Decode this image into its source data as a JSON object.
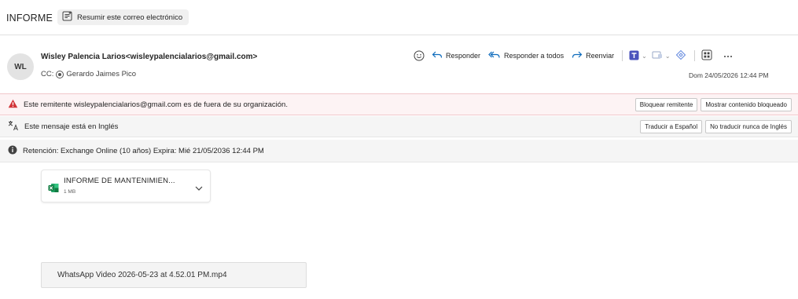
{
  "subject": "INFORME",
  "summarize_label": "Resumir este correo electrónico",
  "sender": {
    "initials": "WL",
    "from_line": "Wisley Palencia Larios<wisleypalencialarios@gmail.com>",
    "cc_prefix": "CC:",
    "cc_name": "Gerardo Jaimes Pico"
  },
  "actions": {
    "reply": "Responder",
    "reply_all": "Responder a todos",
    "forward": "Reenviar"
  },
  "date": "Dom 24/05/2026 12:44 PM",
  "warning_bar": {
    "text": "Este remitente wisleypalencialarios@gmail.com es de fuera de su organización.",
    "block_sender": "Bloquear remitente",
    "show_blocked": "Mostrar contenido bloqueado"
  },
  "language_bar": {
    "text": "Este mensaje está en Inglés",
    "translate": "Traducir a Español",
    "never_translate": "No traducir nunca de Inglés"
  },
  "retention_bar": {
    "text": "Retención: Exchange Online (10 años) Expira: Mié 21/05/2036 12:44 PM"
  },
  "attachment": {
    "name": "INFORME DE MANTENIMIEN...",
    "size": "1 MB"
  },
  "video_attachment": {
    "name": "WhatsApp Video 2026-05-23 at 4.52.01 PM.mp4"
  },
  "colors": {
    "warning_bg": "#fdf3f4",
    "warning_icon": "#d13438",
    "excel_green": "#107c41",
    "accent_blue": "#0f6cbd"
  }
}
